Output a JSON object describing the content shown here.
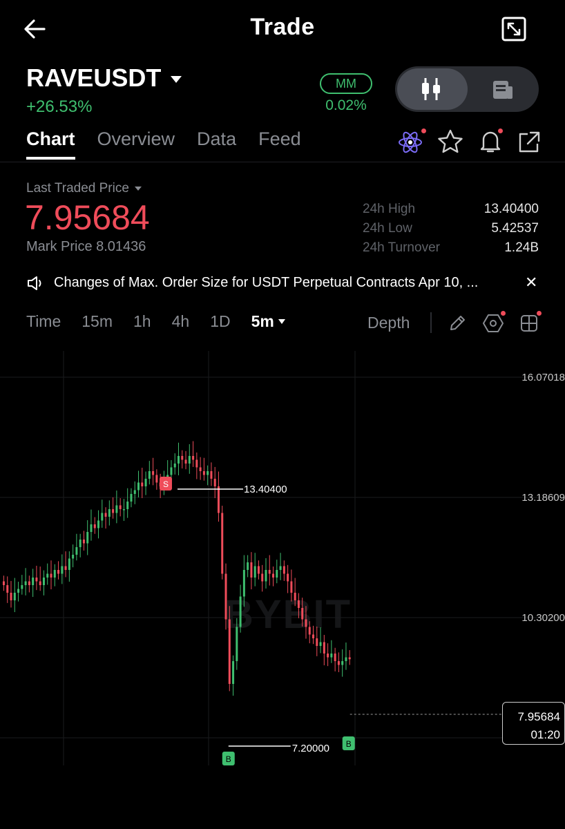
{
  "header": {
    "title": "Trade"
  },
  "ticker": {
    "symbol": "RAVEUSDT",
    "change": "+26.53%",
    "mm_label": "MM",
    "mm_value": "0.02%"
  },
  "tabs": [
    "Chart",
    "Overview",
    "Data",
    "Feed"
  ],
  "price": {
    "ltp_label": "Last Traded Price",
    "last": "7.95684",
    "mark": "Mark Price 8.01436"
  },
  "stats": [
    {
      "label": "24h High",
      "value": "13.40400"
    },
    {
      "label": "24h Low",
      "value": "5.42537"
    },
    {
      "label": "24h Turnover",
      "value": "1.24B"
    }
  ],
  "notice": {
    "text": "Changes of Max. Order Size for USDT Perpetual Contracts Apr 10, ..."
  },
  "timeframes": {
    "items": [
      "Time",
      "15m",
      "1h",
      "4h",
      "1D"
    ],
    "selected": "5m",
    "depth": "Depth"
  },
  "icons": {
    "back": "arrow-left-icon",
    "expand": "expand-icon",
    "candles": "candlestick-icon",
    "doc": "document-icon",
    "ai": "atom-icon",
    "star": "star-icon",
    "bell": "bell-icon",
    "share": "share-icon",
    "speaker": "speaker-icon",
    "draw": "pencil-icon",
    "indicator": "hexagon-settings-icon",
    "layout": "grid-icon"
  },
  "colors": {
    "up": "#3fbf6f",
    "down": "#ef4c5a",
    "background": "#000000"
  },
  "chart_data": {
    "type": "candlestick",
    "interval": "5m",
    "y_ticks": [
      "16.07018",
      "13.18609",
      "10.30200"
    ],
    "ylim": [
      6.5,
      16.5
    ],
    "watermark": "BYBIT",
    "high_marker": {
      "label": "S",
      "value": "13.40400"
    },
    "low_marker": {
      "label": "B",
      "value": "7.20000"
    },
    "buy_marker_2": {
      "label": "B"
    },
    "current": {
      "price": "7.95684",
      "countdown": "01:20"
    },
    "series_close": [
      9.9,
      9.7,
      9.5,
      9.7,
      9.8,
      9.9,
      10.0,
      9.9,
      10.1,
      10.0,
      9.9,
      10.1,
      10.2,
      10.1,
      10.3,
      10.2,
      10.4,
      10.3,
      10.6,
      10.7,
      10.9,
      11.1,
      11.0,
      11.3,
      11.5,
      11.4,
      11.6,
      11.8,
      11.7,
      11.9,
      11.8,
      12.0,
      11.9,
      11.9,
      12.1,
      12.3,
      12.4,
      12.6,
      12.5,
      12.7,
      12.9,
      12.8,
      12.6,
      12.5,
      12.6,
      12.8,
      13.0,
      13.1,
      13.3,
      13.2,
      13.1,
      13.3,
      13.2,
      13.0,
      12.9,
      12.8,
      12.9,
      12.7,
      12.5,
      11.8,
      10.2,
      9.0,
      7.3,
      7.9,
      8.8,
      9.6,
      10.3,
      10.5,
      10.1,
      10.4,
      10.2,
      10.0,
      10.3,
      10.2,
      10.1,
      10.3,
      10.4,
      10.2,
      10.0,
      9.7,
      9.5,
      9.3,
      9.0,
      8.8,
      8.6,
      8.5,
      8.3,
      8.4,
      8.1,
      8.0,
      8.1,
      7.9,
      7.8,
      7.9,
      8.0,
      7.95
    ]
  }
}
